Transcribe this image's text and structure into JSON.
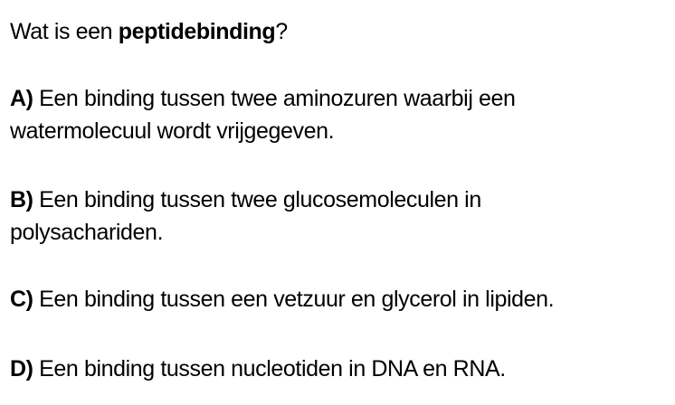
{
  "question": {
    "prefix": "Wat is een ",
    "term": "peptidebinding",
    "suffix": "?"
  },
  "options": [
    {
      "letter": "A)",
      "line1": " Een binding tussen twee aminozuren waarbij een",
      "line2": "watermolecuul wordt vrijgegeven."
    },
    {
      "letter": "B)",
      "line1": " Een binding tussen twee glucosemoleculen in",
      "line2": "polysachariden."
    },
    {
      "letter": "C)",
      "line1": " Een binding tussen een vetzuur en glycerol in lipiden."
    },
    {
      "letter": "D)",
      "line1": " Een binding tussen nucleotiden in DNA en RNA."
    }
  ]
}
